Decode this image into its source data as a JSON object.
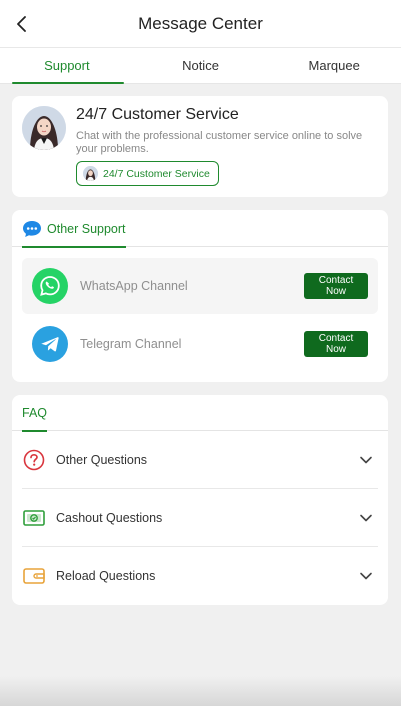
{
  "header": {
    "title": "Message Center",
    "back_icon": "chevron-left-icon"
  },
  "tabs": [
    {
      "label": "Support",
      "active": true
    },
    {
      "label": "Notice",
      "active": false
    },
    {
      "label": "Marquee",
      "active": false
    }
  ],
  "customer_service": {
    "title": "24/7 Customer Service",
    "description": "Chat with the professional customer service online to solve your problems.",
    "button_label": "24/7 Customer Service"
  },
  "other_support": {
    "tab_label": "Other Support",
    "channels": [
      {
        "label": "WhatsApp Channel",
        "icon": "whatsapp-icon",
        "button_label": "Contact Now",
        "color": "#25d366"
      },
      {
        "label": "Telegram Channel",
        "icon": "telegram-icon",
        "button_label": "Contact Now",
        "color": "#2aa1e0"
      }
    ]
  },
  "faq": {
    "tab_label": "FAQ",
    "items": [
      {
        "label": "Other Questions",
        "icon": "question-circle-icon"
      },
      {
        "label": "Cashout Questions",
        "icon": "cashout-icon"
      },
      {
        "label": "Reload Questions",
        "icon": "wallet-icon"
      }
    ]
  },
  "colors": {
    "accent": "#1f8a2e",
    "button": "#0f6a1e",
    "background": "#f0f0f0"
  }
}
